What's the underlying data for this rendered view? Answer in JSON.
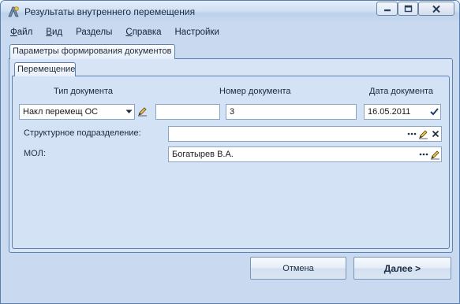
{
  "window": {
    "title": "Результаты внутреннего перемещения"
  },
  "menu": {
    "items": [
      {
        "label": "Файл",
        "mnemonic": "Ф",
        "rest": "айл"
      },
      {
        "label": "Вид",
        "mnemonic": "В",
        "rest": "ид"
      },
      {
        "label": "Разделы",
        "mnemonic": "Р",
        "rest": "азделы"
      },
      {
        "label": "Справка",
        "mnemonic": "С",
        "rest": "правка"
      },
      {
        "label": "Настройки",
        "mnemonic": "Н",
        "rest": "астройки"
      }
    ]
  },
  "tabs": {
    "outer": "Параметры формирования документов",
    "inner": "Перемещение"
  },
  "form": {
    "doc_type_label": "Тип документа",
    "doc_type_value": "Накл перемещ ОС",
    "extra_value": "",
    "doc_number_label": "Номер документа",
    "doc_number_value": "3",
    "doc_date_label": "Дата документа",
    "doc_date_value": "16.05.2011",
    "division_label": "Структурное подразделение:",
    "division_value": "",
    "mol_label": "МОЛ:",
    "mol_value": "Богатырев В.А."
  },
  "buttons": {
    "cancel": "Отмена",
    "next": "Далее >"
  },
  "icons": {
    "app": "move-document-icon",
    "dropdown": "chevron-down-icon",
    "edit": "pencil-edit-icon",
    "ellipsis": "ellipsis-icon",
    "clear": "clear-x-icon",
    "check": "checkmark-icon"
  },
  "colors": {
    "window_bg": "#c9daf0",
    "panel_bg": "#d3e2f4",
    "border": "#5d81b1"
  }
}
